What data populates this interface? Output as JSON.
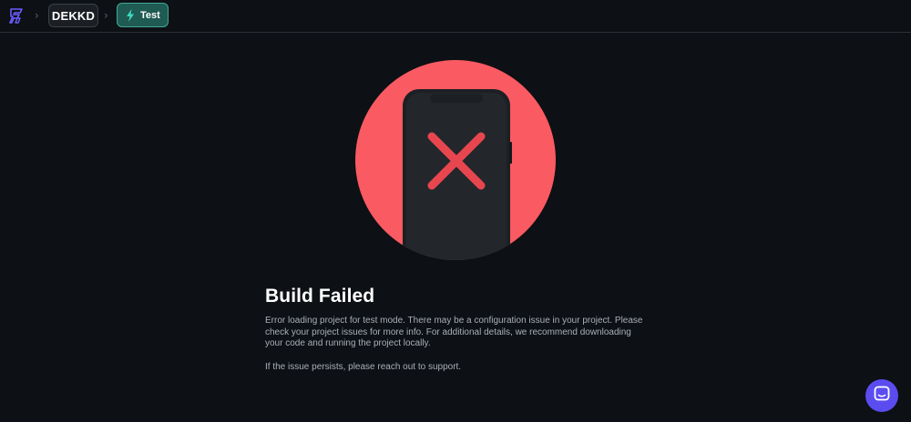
{
  "header": {
    "logo_icon": "flutterflow-logo-icon",
    "separator_glyph": "›",
    "breadcrumbs": [
      {
        "label": "DEKKD",
        "icon": null
      },
      {
        "label": "Test",
        "icon": "lightning-icon"
      }
    ]
  },
  "main": {
    "illustration": "phone-error-icon",
    "title": "Build Failed",
    "message": "Error loading project for test mode. There may be a configuration issue in your project. Please check your project issues for more info. For additional details, we recommend downloading your code and running the project locally.",
    "message_support": "If the issue persists, please reach out to support."
  },
  "chat": {
    "icon": "chat-icon"
  },
  "colors": {
    "background": "#0d1014",
    "error_circle": "#fa5a62",
    "test_badge_bg": "#1f5a53",
    "test_badge_border": "#3fa898",
    "chat_button": "#5b4cf0",
    "logo": "#6b5cff"
  }
}
